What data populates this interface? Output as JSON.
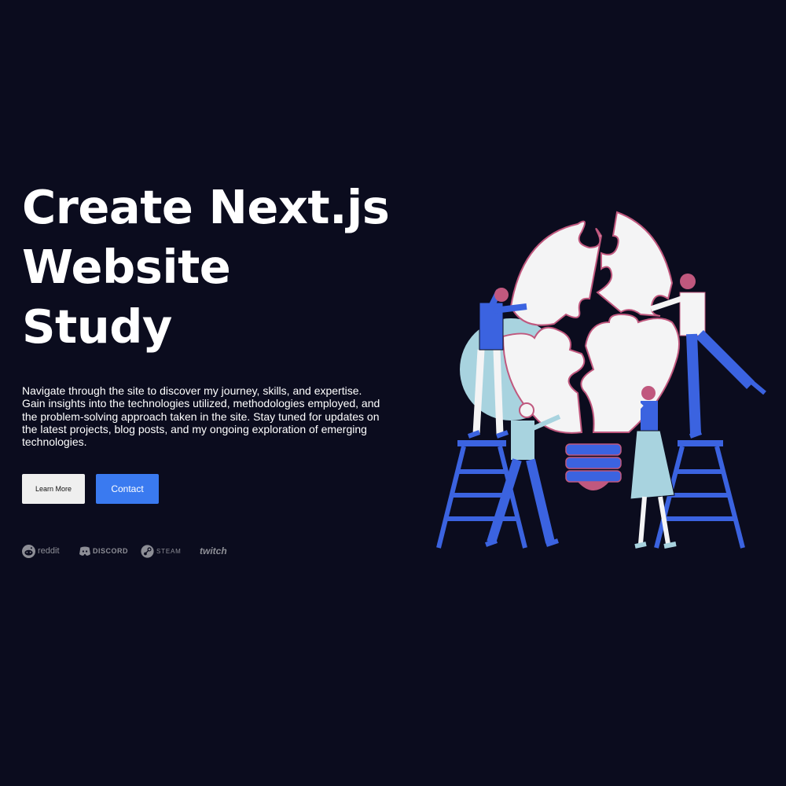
{
  "hero": {
    "title_lines": [
      "Create Next.js",
      "Website",
      "Study"
    ],
    "description": "Navigate through the site to discover my journey, skills, and expertise. Gain insights into the technologies utilized, methodologies employed, and the problem-solving approach taken in the site. Stay tuned for updates on the latest projects, blog posts, and my ongoing exploration of emerging technologies."
  },
  "buttons": {
    "learn_more": "Learn More",
    "contact": "Contact"
  },
  "logos": [
    {
      "name": "reddit",
      "icon": "reddit-icon"
    },
    {
      "name": "DISCORD",
      "icon": "discord-icon"
    },
    {
      "name": "STEAM",
      "icon": "steam-icon"
    },
    {
      "name": "twitch",
      "icon": "twitch-icon"
    }
  ],
  "illustration": {
    "icon": "puzzle-lightbulb-illustration"
  },
  "colors": {
    "background": "#0b0c1e",
    "accent_blue": "#3a7af0",
    "light_button": "#efefef",
    "logo_gray": "#8d8e96",
    "illustration_blue": "#3b63e0",
    "illustration_teal": "#a8d3df",
    "illustration_pink": "#c0587e"
  }
}
